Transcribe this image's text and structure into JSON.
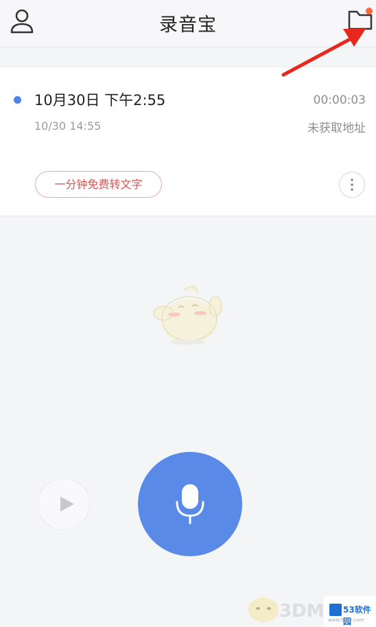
{
  "header": {
    "title": "录音宝",
    "left_icon": "user-icon",
    "right_icon": "folder-icon",
    "notification_color": "#ff6a3d"
  },
  "recording": {
    "title": "10月30日 下午2:55",
    "duration": "00:00:03",
    "datetime": "10/30  14:55",
    "location": "未获取地址",
    "convert_label": "一分钟免费转文字",
    "more_icon": "more-vertical-icon",
    "status_color": "#4d84e8"
  },
  "controls": {
    "play_icon": "play-icon",
    "mic_icon": "microphone-icon",
    "accent": "#5a8ae8"
  },
  "annotation": {
    "arrow_color": "#e8281c"
  },
  "watermark": {
    "text": "3DM",
    "brand": "53软件园",
    "url": "www.53xz.com"
  }
}
